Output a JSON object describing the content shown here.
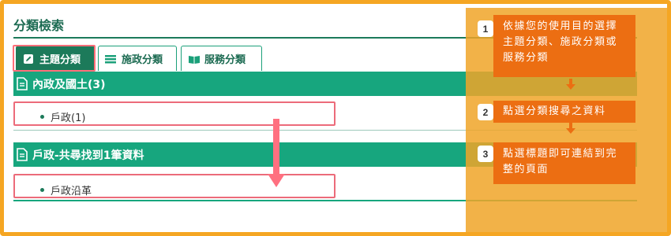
{
  "page": {
    "title": "分類檢索"
  },
  "tabs": [
    {
      "label": "主題分類",
      "icon": "edit-icon",
      "active": true
    },
    {
      "label": "施政分類",
      "icon": "list-icon",
      "active": false
    },
    {
      "label": "服務分類",
      "icon": "book-icon",
      "active": false
    }
  ],
  "sections": [
    {
      "heading": "內政及國土(3)",
      "items": [
        "戶政(1)"
      ]
    },
    {
      "heading": "戶政-共尋找到1筆資料",
      "items": [
        "戶政沿革"
      ]
    }
  ],
  "guide": {
    "steps": [
      {
        "number": "1",
        "text": "依據您的使用目的選擇主題分類、施政分類或服務分類"
      },
      {
        "number": "2",
        "text": "點選分類搜尋之資料"
      },
      {
        "number": "3",
        "text": "點選標題即可連結到完整的頁面"
      }
    ]
  },
  "colors": {
    "accent_green": "#17a67e",
    "dark_green": "#1c7a5a",
    "highlight_red": "#ec6b7a",
    "overlay_orange": "#f0a528",
    "callout_orange": "#ec6e12"
  }
}
